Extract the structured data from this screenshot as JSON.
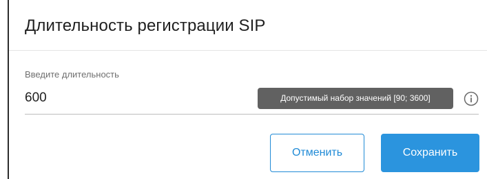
{
  "dialog": {
    "title": "Длительность регистрации SIP"
  },
  "field": {
    "label": "Введите длительность",
    "value": "600",
    "tooltip": "Допустимый набор значений [90; 3600]",
    "info_icon": "info-circle-icon"
  },
  "actions": {
    "cancel_label": "Отменить",
    "save_label": "Сохранить"
  },
  "colors": {
    "accent": "#2b94de",
    "accent_outline": "#1f8ad6",
    "tooltip_bg": "#616161"
  }
}
